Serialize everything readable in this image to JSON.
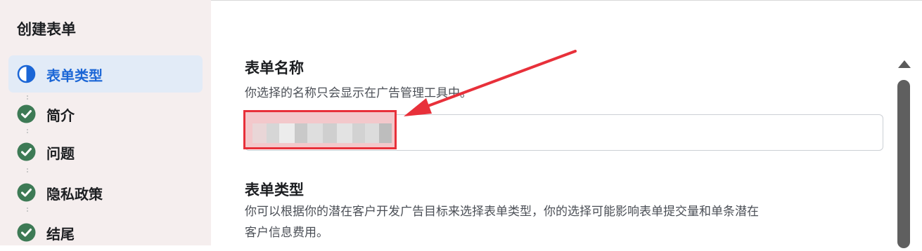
{
  "sidebar": {
    "title": "创建表单",
    "steps": [
      {
        "label": "表单类型",
        "status": "in-progress",
        "icon": "half-circle-icon"
      },
      {
        "label": "简介",
        "status": "done",
        "icon": "check-circle-icon"
      },
      {
        "label": "问题",
        "status": "done",
        "icon": "check-circle-icon"
      },
      {
        "label": "隐私政策",
        "status": "done",
        "icon": "check-circle-icon"
      },
      {
        "label": "结尾",
        "status": "done",
        "icon": "check-circle-icon"
      }
    ]
  },
  "form_name": {
    "heading": "表单名称",
    "description": "你选择的名称只会显示在广告管理工具中。",
    "value": ""
  },
  "form_type": {
    "heading": "表单类型",
    "description_line1": "你可以根据你的潜在客户开发广告目标来选择表单类型，你的选择可能影响表单提交量和单条潜在",
    "description_line2": "客户信息费用。"
  },
  "colors": {
    "accent": "#1b66d6",
    "check_green": "#3d7a55",
    "annotation_red": "#e8303a"
  }
}
